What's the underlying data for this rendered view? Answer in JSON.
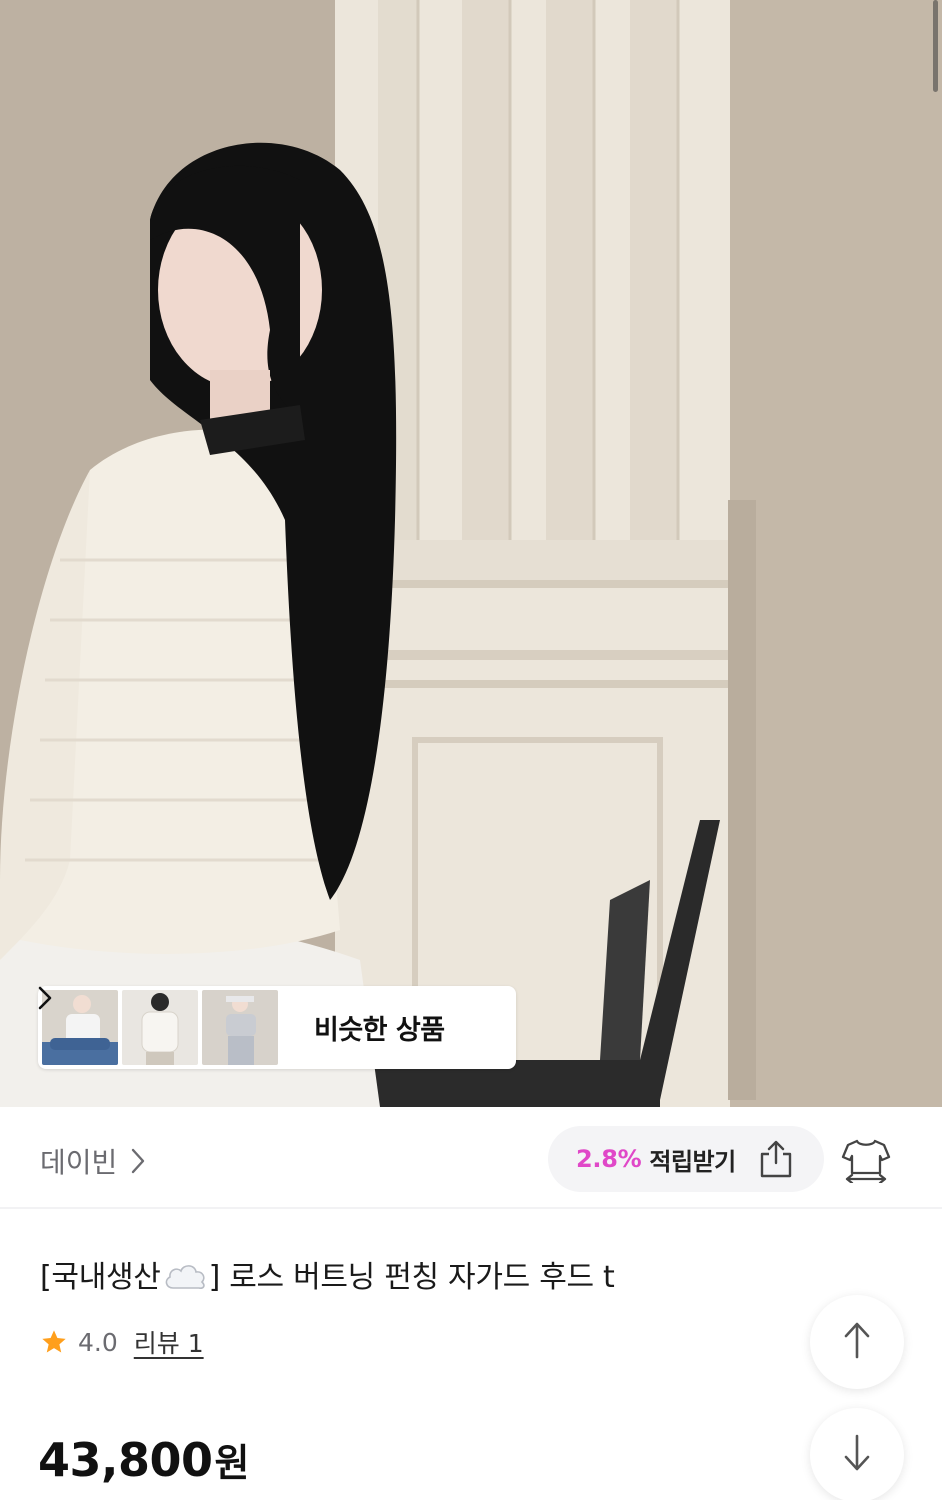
{
  "similar_products": {
    "label": "비슷한 상품",
    "thumbnails": [
      "similar-thumb-1",
      "similar-thumb-2",
      "similar-thumb-3"
    ]
  },
  "brand": {
    "name": "데이빈"
  },
  "reward": {
    "rate": "2.8%",
    "label": "적립받기"
  },
  "product": {
    "title_prefix": "[국내생산",
    "title_suffix": "] 로스 버트닝 펀칭 자가드 후드 t",
    "rating": "4.0",
    "review_label": "리뷰 1",
    "price": "43,800",
    "price_unit": "원"
  },
  "colors": {
    "accent_pink": "#e048c8",
    "star": "#ff9f1c"
  },
  "icons": [
    "chevron-right-icon",
    "share-icon",
    "fitting-icon",
    "star-icon",
    "cloud-icon",
    "arrow-up-icon",
    "arrow-down-icon"
  ]
}
